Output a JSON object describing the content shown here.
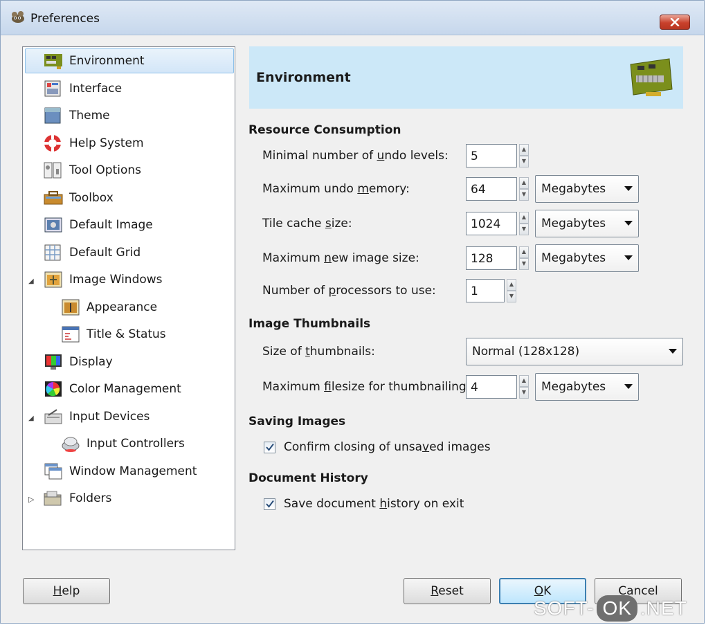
{
  "window": {
    "title": "Preferences",
    "app_icon": "gimp-wilber-icon",
    "close_icon": "close-icon"
  },
  "nav": {
    "items": [
      {
        "label": "Environment",
        "icon": "circuit-board-icon",
        "selected": true
      },
      {
        "label": "Interface",
        "icon": "interface-icon"
      },
      {
        "label": "Theme",
        "icon": "theme-icon"
      },
      {
        "label": "Help System",
        "icon": "lifebuoy-icon"
      },
      {
        "label": "Tool Options",
        "icon": "tool-options-icon"
      },
      {
        "label": "Toolbox",
        "icon": "toolbox-icon"
      },
      {
        "label": "Default Image",
        "icon": "default-image-icon"
      },
      {
        "label": "Default Grid",
        "icon": "grid-icon"
      },
      {
        "label": "Image Windows",
        "icon": "image-windows-icon",
        "expander": "expanded"
      },
      {
        "label": "Appearance",
        "icon": "appearance-icon"
      },
      {
        "label": "Title & Status",
        "icon": "title-status-icon"
      },
      {
        "label": "Display",
        "icon": "display-icon"
      },
      {
        "label": "Color Management",
        "icon": "color-wheel-icon"
      },
      {
        "label": "Input Devices",
        "icon": "input-devices-icon",
        "expander": "expanded"
      },
      {
        "label": "Input Controllers",
        "icon": "input-controllers-icon"
      },
      {
        "label": "Window Management",
        "icon": "window-management-icon"
      },
      {
        "label": "Folders",
        "icon": "folder-icon",
        "expander": "collapsed"
      }
    ]
  },
  "header": {
    "title": "Environment",
    "icon": "circuit-board-icon"
  },
  "resource": {
    "title": "Resource Consumption",
    "undo_levels": {
      "label_pre": "Minimal number of ",
      "label_u": "u",
      "label_post": "ndo levels:",
      "value": "5"
    },
    "undo_memory": {
      "label_pre": "Maximum undo ",
      "label_u": "m",
      "label_post": "emory:",
      "value": "64",
      "unit": "Megabytes"
    },
    "tile_cache": {
      "label_pre": "Tile cache ",
      "label_u": "s",
      "label_post": "ize:",
      "value": "1024",
      "unit": "Megabytes"
    },
    "new_image_size": {
      "label_pre": "Maximum ",
      "label_u": "n",
      "label_post": "ew image size:",
      "value": "128",
      "unit": "Megabytes"
    },
    "processors": {
      "label_pre": "Number of ",
      "label_u": "p",
      "label_post": "rocessors to use:",
      "value": "1"
    }
  },
  "thumbnails": {
    "title": "Image Thumbnails",
    "size": {
      "label_pre": "Size of ",
      "label_u": "t",
      "label_post": "humbnails:",
      "value": "Normal (128x128)"
    },
    "max_filesize": {
      "label_pre": "Maximum ",
      "label_u": "f",
      "label_post": "ilesize for thumbnailing:",
      "value": "4",
      "unit": "Megabytes"
    }
  },
  "saving": {
    "title": "Saving Images",
    "confirm": {
      "label_pre": "Confirm closing of unsa",
      "label_u": "v",
      "label_post": "ed images",
      "checked": true
    }
  },
  "history": {
    "title": "Document History",
    "save": {
      "label_pre": "Save document ",
      "label_u": "h",
      "label_post": "istory on exit",
      "checked": true
    }
  },
  "buttons": {
    "help": {
      "u": "H",
      "rest": "elp"
    },
    "reset": {
      "u": "R",
      "rest": "eset"
    },
    "ok": {
      "u": "O",
      "rest": "K"
    },
    "cancel": {
      "u": "C",
      "rest": "ancel"
    }
  },
  "watermark": {
    "part1": "SOFT-",
    "part2": "OK",
    "part3": ".NET"
  }
}
